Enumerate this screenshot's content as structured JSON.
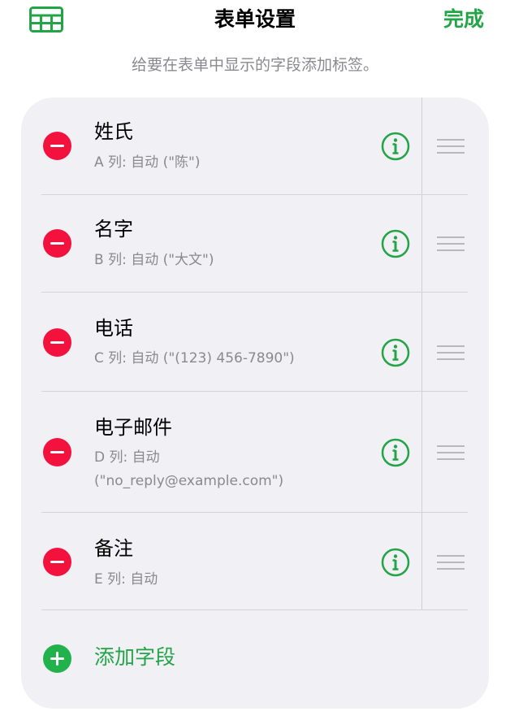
{
  "header": {
    "title": "表单设置",
    "done_label": "完成",
    "subtitle": "给要在表单中显示的字段添加标签。",
    "left_icon": "table-icon"
  },
  "fields": [
    {
      "label": "姓氏",
      "detail": "A 列: 自动 (\"陈\")"
    },
    {
      "label": "名字",
      "detail": "B 列: 自动 (\"大文\")"
    },
    {
      "label": "电话",
      "detail": "C 列: 自动 (\"(123) 456-7890\")"
    },
    {
      "label": "电子邮件",
      "detail": "D 列: 自动 (\"no_reply@example.com\")"
    },
    {
      "label": "备注",
      "detail": "E 列: 自动"
    }
  ],
  "add_field": {
    "label": "添加字段"
  },
  "icons": {
    "remove": "minus-circle-icon",
    "info": "info-circle-icon",
    "drag": "drag-handle-icon",
    "add": "plus-circle-icon"
  },
  "colors": {
    "accent_green": "#22a447",
    "delete_red": "#f2123d",
    "add_green": "#22b24b",
    "secondary_text": "#8a8a8e",
    "card_background": "#f0f0f5"
  }
}
